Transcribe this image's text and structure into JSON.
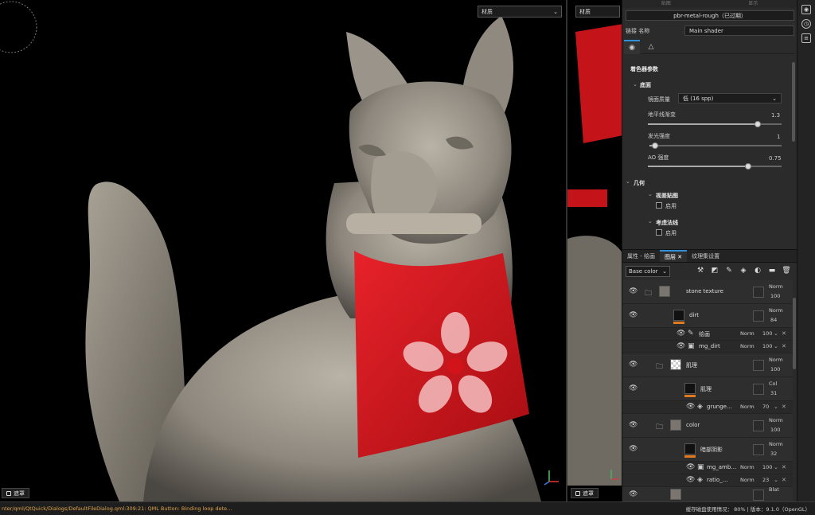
{
  "viewport3d": {
    "material_dropdown": "材质",
    "mask_button": "遮罩",
    "axis_labels": {
      "x": "X",
      "y": "Y",
      "z": "Z"
    }
  },
  "viewport2d": {
    "material_dropdown": "材质",
    "mask_button": "遮罩"
  },
  "texture_set": {
    "top_tabs": [
      "贴图",
      "显示"
    ],
    "shader_name": "pbr-metal-rough（已过期）",
    "shader_link_label": "链接 名称",
    "shader_link_value": "Main shader",
    "section_title": "着色器参数",
    "group_base": "底面",
    "sample_quality_label": "镜面质量",
    "sample_quality_value": "低 (16 spp)",
    "horizon_fade_label": "地平线渐变",
    "horizon_fade_value": "1.3",
    "horizon_fade_fraction": 0.82,
    "emissive_label": "发光强度",
    "emissive_value": "1",
    "emissive_fraction": 0.04,
    "ao_label": "AO 强度",
    "ao_value": "0.75",
    "ao_fraction": 0.75,
    "group_geometry": "几何",
    "parallax_label": "视差贴图",
    "parallax_check_label": "启用",
    "normal_label": "考虑法线",
    "normal_check_label": "启用"
  },
  "layers_panel": {
    "tabs": [
      "属性 - 绘画",
      "图层",
      "纹理集设置"
    ],
    "channel": "Base color",
    "rows": [
      {
        "name": "stone texture",
        "blend": "Norm",
        "opacity": "100"
      },
      {
        "name": "dirt",
        "blend": "Norm",
        "opacity": "84"
      },
      {
        "name": "绘画",
        "blend": "Norm",
        "opacity": "100"
      },
      {
        "name": "mg_dirt",
        "blend": "Norm",
        "opacity": "100"
      },
      {
        "name": "肌理",
        "blend": "Norm",
        "opacity": "100"
      },
      {
        "name": "肌理",
        "blend": "Col",
        "opacity": "31"
      },
      {
        "name": "grunge…",
        "blend": "Norm",
        "opacity": "70"
      },
      {
        "name": "color",
        "blend": "Norm",
        "opacity": "100"
      },
      {
        "name": "暗部阴影",
        "blend": "Norm",
        "opacity": "32"
      },
      {
        "name": "mg_amb…",
        "blend": "Norm",
        "opacity": "100"
      },
      {
        "name": "ratio_…",
        "blend": "Norm",
        "opacity": "23"
      },
      {
        "name": "",
        "blend": "Blat",
        "opacity": ""
      }
    ]
  },
  "status_bar": {
    "message": "nter/qml/QtQuick/Dialogs/DefaultFileDialog.qml:309:21: QML Button: Binding loop dete…",
    "cache_label": "缓存磁盘使用情况：",
    "cache_value": "80%",
    "version": "| 版本：9.1.0（OpenGL）"
  },
  "colors": {
    "accent": "#2f8fd8",
    "bandana": "#d4141a",
    "layer_orange": "#e07a1e"
  }
}
